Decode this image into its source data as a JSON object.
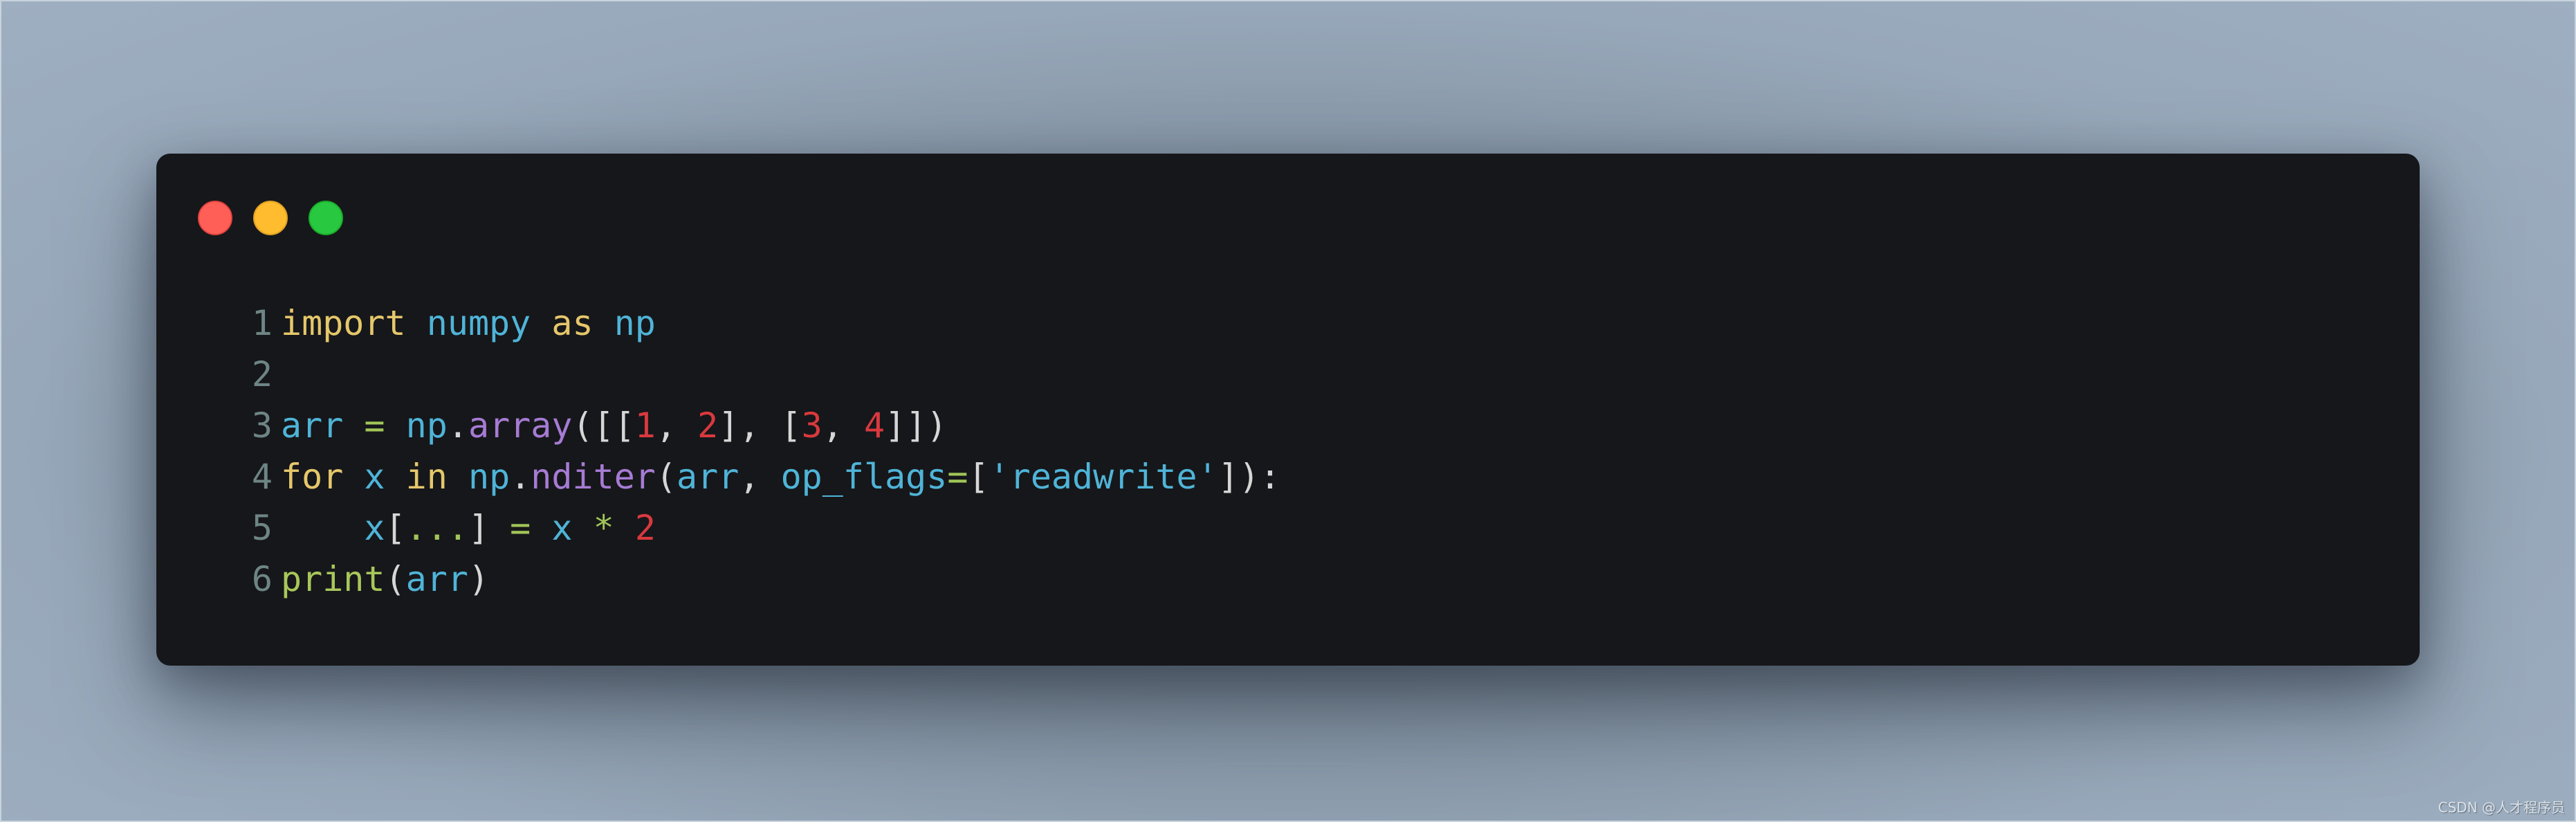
{
  "window": {
    "traffic_lights": [
      {
        "name": "close",
        "color": "#ff5f57"
      },
      {
        "name": "minimize",
        "color": "#febc2e"
      },
      {
        "name": "maximize",
        "color": "#28c840"
      }
    ]
  },
  "code": {
    "language": "python",
    "lines": [
      {
        "number": "1",
        "tokens": [
          {
            "t": "import",
            "c": "kw"
          },
          {
            "t": " ",
            "c": "pn"
          },
          {
            "t": "numpy",
            "c": "id"
          },
          {
            "t": " ",
            "c": "pn"
          },
          {
            "t": "as",
            "c": "kw"
          },
          {
            "t": " ",
            "c": "pn"
          },
          {
            "t": "np",
            "c": "id"
          }
        ]
      },
      {
        "number": "2",
        "tokens": []
      },
      {
        "number": "3",
        "tokens": [
          {
            "t": "arr",
            "c": "id"
          },
          {
            "t": " ",
            "c": "pn"
          },
          {
            "t": "=",
            "c": "op"
          },
          {
            "t": " ",
            "c": "pn"
          },
          {
            "t": "np",
            "c": "id"
          },
          {
            "t": ".",
            "c": "pn"
          },
          {
            "t": "array",
            "c": "fn"
          },
          {
            "t": "([[",
            "c": "pn"
          },
          {
            "t": "1",
            "c": "num"
          },
          {
            "t": ", ",
            "c": "pn"
          },
          {
            "t": "2",
            "c": "num"
          },
          {
            "t": "], [",
            "c": "pn"
          },
          {
            "t": "3",
            "c": "num"
          },
          {
            "t": ", ",
            "c": "pn"
          },
          {
            "t": "4",
            "c": "num"
          },
          {
            "t": "]])",
            "c": "pn"
          }
        ]
      },
      {
        "number": "4",
        "tokens": [
          {
            "t": "for",
            "c": "kw"
          },
          {
            "t": " ",
            "c": "pn"
          },
          {
            "t": "x",
            "c": "id"
          },
          {
            "t": " ",
            "c": "pn"
          },
          {
            "t": "in",
            "c": "kw"
          },
          {
            "t": " ",
            "c": "pn"
          },
          {
            "t": "np",
            "c": "id"
          },
          {
            "t": ".",
            "c": "pn"
          },
          {
            "t": "nditer",
            "c": "fn"
          },
          {
            "t": "(",
            "c": "pn"
          },
          {
            "t": "arr",
            "c": "id"
          },
          {
            "t": ", ",
            "c": "pn"
          },
          {
            "t": "op_flags",
            "c": "id"
          },
          {
            "t": "=",
            "c": "op"
          },
          {
            "t": "[",
            "c": "pn"
          },
          {
            "t": "'readwrite'",
            "c": "str"
          },
          {
            "t": "]):",
            "c": "pn"
          }
        ]
      },
      {
        "number": "5",
        "tokens": [
          {
            "t": "    ",
            "c": "pn"
          },
          {
            "t": "x",
            "c": "id"
          },
          {
            "t": "[",
            "c": "pn"
          },
          {
            "t": "...",
            "c": "op"
          },
          {
            "t": "]",
            "c": "pn"
          },
          {
            "t": " ",
            "c": "pn"
          },
          {
            "t": "=",
            "c": "op"
          },
          {
            "t": " ",
            "c": "pn"
          },
          {
            "t": "x",
            "c": "id"
          },
          {
            "t": " ",
            "c": "pn"
          },
          {
            "t": "*",
            "c": "op"
          },
          {
            "t": " ",
            "c": "pn"
          },
          {
            "t": "2",
            "c": "num"
          }
        ]
      },
      {
        "number": "6",
        "tokens": [
          {
            "t": "print",
            "c": "bi"
          },
          {
            "t": "(",
            "c": "pn"
          },
          {
            "t": "arr",
            "c": "id"
          },
          {
            "t": ")",
            "c": "pn"
          }
        ]
      }
    ]
  },
  "watermark": "CSDN @人才程序员"
}
